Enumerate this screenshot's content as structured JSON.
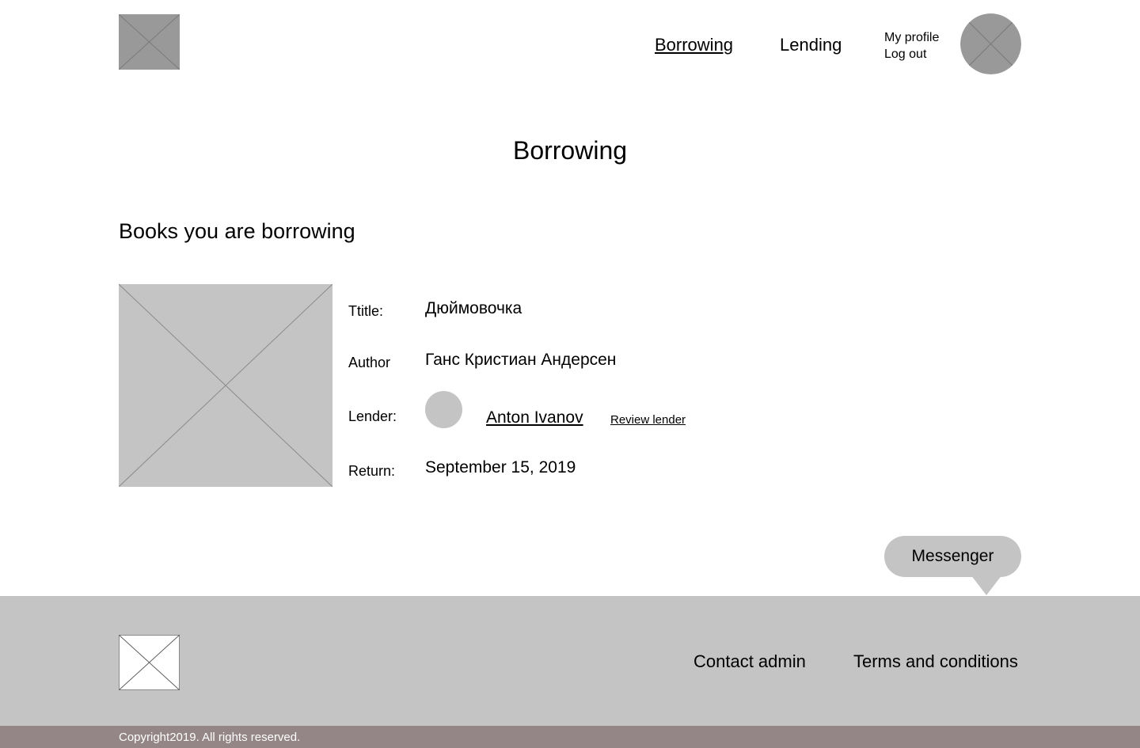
{
  "colors": {
    "placeholder_dark": "#999999",
    "placeholder_light": "#c4c4c4",
    "footer_bg": "#c4c4c4",
    "copyright_bg": "#948686"
  },
  "header": {
    "logo_icon": "image-placeholder-icon",
    "nav": {
      "borrowing": "Borrowing",
      "lending": "Lending"
    },
    "account": {
      "my_profile": "My profile",
      "log_out": "Log out"
    },
    "avatar_icon": "user-avatar-placeholder-icon"
  },
  "main": {
    "page_title": "Borrowing",
    "section_title": "Books you are borrowing",
    "book": {
      "cover_icon": "image-placeholder-icon",
      "title_label": "Ttitle:",
      "title_value": "Дюймовочка",
      "author_label": "Author",
      "author_value": "Ганс Кристиан Андерсен",
      "lender_label": "Lender:",
      "lender_name": "Anton Ivanov",
      "review_lender": "Review lender",
      "return_label": "Return:",
      "return_value": "September 15, 2019"
    },
    "messenger": "Messenger"
  },
  "footer": {
    "logo_icon": "image-placeholder-icon",
    "contact_admin": "Contact admin",
    "terms": "Terms and conditions",
    "copyright": "Copyright2019. All rights reserved."
  }
}
